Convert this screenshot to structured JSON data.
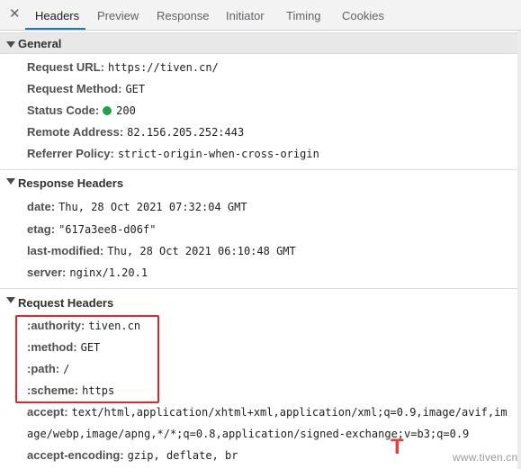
{
  "tabs": [
    {
      "label": "Headers",
      "active": true
    },
    {
      "label": "Preview"
    },
    {
      "label": "Response"
    },
    {
      "label": "Initiator"
    },
    {
      "label": "Timing"
    },
    {
      "label": "Cookies"
    }
  ],
  "close_glyph": "✕",
  "general": {
    "title": "General",
    "rows": [
      {
        "key": "Request URL:",
        "value": "https://tiven.cn/"
      },
      {
        "key": "Request Method:",
        "value": "GET"
      },
      {
        "key": "Status Code:",
        "value": "200",
        "status_color": "#1ea446"
      },
      {
        "key": "Remote Address:",
        "value": "82.156.205.252:443"
      },
      {
        "key": "Referrer Policy:",
        "value": "strict-origin-when-cross-origin"
      }
    ]
  },
  "response_headers": {
    "title": "Response Headers",
    "rows": [
      {
        "key": "date:",
        "value": "Thu, 28 Oct 2021 07:32:04 GMT"
      },
      {
        "key": "etag:",
        "value": "\"617a3ee8-d06f\""
      },
      {
        "key": "last-modified:",
        "value": "Thu, 28 Oct 2021 06:10:48 GMT"
      },
      {
        "key": "server:",
        "value": "nginx/1.20.1"
      }
    ]
  },
  "request_headers": {
    "title": "Request Headers",
    "rows": [
      {
        "key": ":authority:",
        "value": "tiven.cn"
      },
      {
        "key": ":method:",
        "value": "GET"
      },
      {
        "key": ":path:",
        "value": "/"
      },
      {
        "key": ":scheme:",
        "value": "https"
      },
      {
        "key": "accept:",
        "value": "text/html,application/xhtml+xml,application/xml;q=0.9,image/avif,im",
        "continuation": "age/webp,image/apng,*/*;q=0.8,application/signed-exchange;v=b3;q=0.9"
      },
      {
        "key": "accept-encoding:",
        "value": "gzip, deflate, br"
      }
    ]
  },
  "highlight_color": "#e0262b",
  "watermark": {
    "glyph": "T",
    "text": "www.tiven.cn"
  }
}
